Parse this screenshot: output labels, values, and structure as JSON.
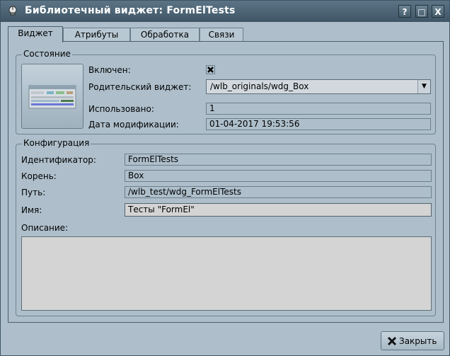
{
  "window": {
    "title": "Библиотечный виджет: FormElTests",
    "help_label": "?",
    "maximize_label": "□",
    "close_label": "X"
  },
  "tabs": [
    {
      "label": "Виджет",
      "active": true
    },
    {
      "label": "Атрибуты",
      "active": false
    },
    {
      "label": "Обработка",
      "active": false
    },
    {
      "label": "Связи",
      "active": false
    }
  ],
  "state": {
    "group_title": "Состояние",
    "enabled_label": "Включен:",
    "enabled_checked": true,
    "parent_label": "Родительский виджет:",
    "parent_value": "/wlb_originals/wdg_Box",
    "used_label": "Использовано:",
    "used_value": "1",
    "modified_label": "Дата модификации:",
    "modified_value": "01-04-2017 19:53:56"
  },
  "config": {
    "group_title": "Конфигурация",
    "id_label": "Идентификатор:",
    "id_value": "FormElTests",
    "root_label": "Корень:",
    "root_value": "Box",
    "path_label": "Путь:",
    "path_value": "/wlb_test/wdg_FormElTests",
    "name_label": "Имя:",
    "name_value": "Тесты \"FormEl\"",
    "description_label": "Описание:",
    "description_value": ""
  },
  "footer": {
    "close_label": "Закрыть"
  },
  "icons": {
    "title_icon": "lamp-icon",
    "preview": "widget-preview-image",
    "close_button_icon": "close-x-icon"
  },
  "colors": {
    "window_bg": "#aebfcb",
    "titlebar": "#3f5566",
    "field_light": "#d4d4d4"
  }
}
